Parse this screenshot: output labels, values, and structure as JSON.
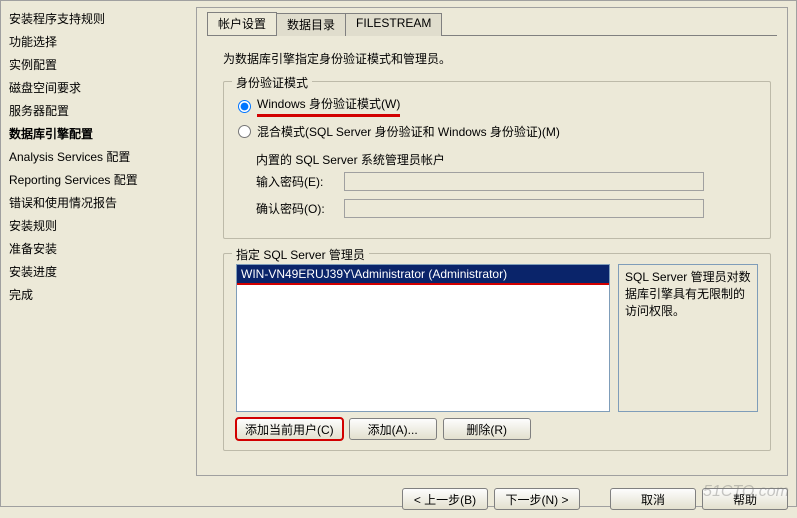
{
  "sidebar": {
    "items": [
      "安装程序支持规则",
      "功能选择",
      "实例配置",
      "磁盘空间要求",
      "服务器配置",
      "数据库引擎配置",
      "Analysis Services 配置",
      "Reporting Services 配置",
      "错误和使用情况报告",
      "安装规则",
      "准备安装",
      "安装进度",
      "完成"
    ],
    "selected_index": 5
  },
  "tabs": {
    "items": [
      "帐户设置",
      "数据目录",
      "FILESTREAM"
    ],
    "active_index": 0
  },
  "hint": "为数据库引擎指定身份验证模式和管理员。",
  "auth_group": {
    "title": "身份验证模式",
    "windows_mode": "Windows 身份验证模式(W)",
    "mixed_mode": "混合模式(SQL Server 身份验证和 Windows 身份验证)(M)",
    "selected": "windows",
    "builtin_caption": "内置的 SQL Server 系统管理员帐户",
    "enter_pwd_label": "输入密码(E):",
    "confirm_pwd_label": "确认密码(O):",
    "enter_pwd_value": "",
    "confirm_pwd_value": ""
  },
  "admin_group": {
    "title": "指定 SQL Server 管理员",
    "list_items": [
      "WIN-VN49ERUJ39Y\\Administrator (Administrator)"
    ],
    "selected_index": 0,
    "desc": "SQL Server 管理员对数据库引擎具有无限制的访问权限。"
  },
  "admin_buttons": {
    "add_current": "添加当前用户(C)",
    "add": "添加(A)...",
    "remove": "删除(R)"
  },
  "footer": {
    "back": "< 上一步(B)",
    "next": "下一步(N) >",
    "cancel": "取消",
    "help": "帮助"
  },
  "watermark": "51CTO.com"
}
